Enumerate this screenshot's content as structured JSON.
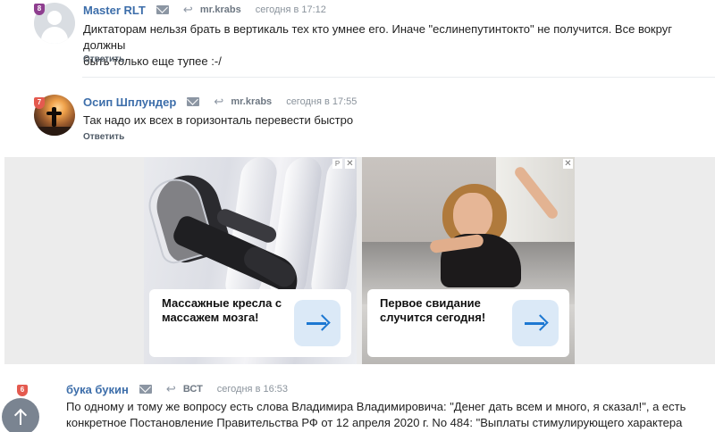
{
  "comments": [
    {
      "username": "Master RLT",
      "level": "8",
      "reply_to": "mr.krabs",
      "timestamp": "сегодня в 17:12",
      "text_lines": [
        "Диктаторам нельзя брать в вертикаль тех кто умнее его. Иначе \"еслинепутинтокто\" не получится. Все вокруг должны",
        "быть только еще тупее :-/"
      ],
      "reply_label": "Ответить"
    },
    {
      "username": "Осип Шплундер",
      "level": "7",
      "reply_to": "mr.krabs",
      "timestamp": "сегодня в 17:55",
      "text_lines": [
        "Так надо их всех в горизонталь перевести быстро"
      ],
      "reply_label": "Ответить"
    },
    {
      "username": "бука букин",
      "level": "6",
      "reply_to": "ВСТ",
      "timestamp": "сегодня в 16:53",
      "text_lines": [
        "По одному и тому же вопросу есть слова Владимира Владимировича: \"Денег дать всем и много, я сказал!\", а есть",
        "конкретное Постановление Правительства РФ от 12 апреля 2020 г. No 484: \"Выплаты стимулирующего характера"
      ]
    }
  ],
  "ads": [
    {
      "title": "Массажные кресла с массажем мозга!",
      "close": "✕",
      "marker": "P"
    },
    {
      "title": "Первое свидание случится сегодня!",
      "close": "✕"
    }
  ],
  "colors": {
    "username": "#3d6eaa",
    "badge_purple": "#8e3e8f",
    "badge_red": "#e45a4f",
    "ad_arrow": "#1d78d2"
  },
  "icons": {
    "mail": "mail-icon",
    "reply": "reply-arrow-icon",
    "scroll_top": "arrow-up-icon"
  }
}
